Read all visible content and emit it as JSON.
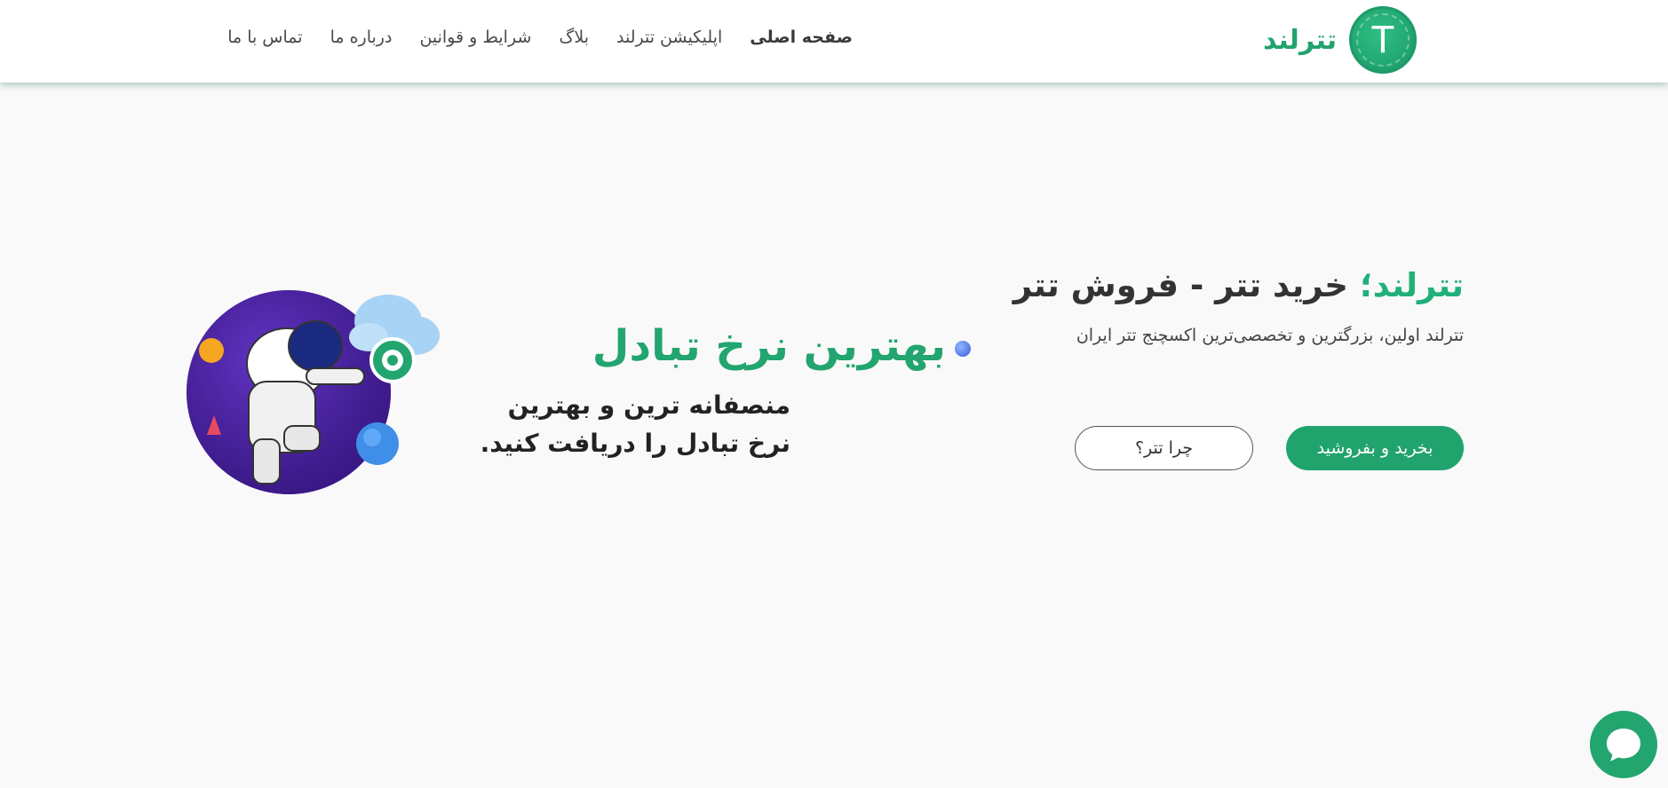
{
  "brand": {
    "name": "تترلند",
    "coin_letter": "T",
    "accent": "#21a36d"
  },
  "nav": {
    "items": [
      {
        "label": "صفحه اصلی",
        "active": true
      },
      {
        "label": "اپلیکیشن تترلند"
      },
      {
        "label": "بلاگ"
      },
      {
        "label": "شرایط و قوانین"
      },
      {
        "label": "درباره ما"
      },
      {
        "label": "تماس با ما"
      }
    ]
  },
  "hero": {
    "brand_prefix": "تترلند؛",
    "title": " خرید تتر - فروش تتر",
    "subtitle": "تترلند اولین، بزرگترین و تخصصی‌ترین اکسچنج تتر ایران",
    "primary_button": "بخرید و بفروشید",
    "secondary_button": "چرا تتر؟"
  },
  "banner": {
    "headline": "بهترین نرخ تبادل",
    "line1": "منصفانه ترین و بهترین",
    "line2": "نرخ تبادل را دریافت کنید."
  },
  "chat": {
    "icon": "chat-bubble-icon"
  }
}
